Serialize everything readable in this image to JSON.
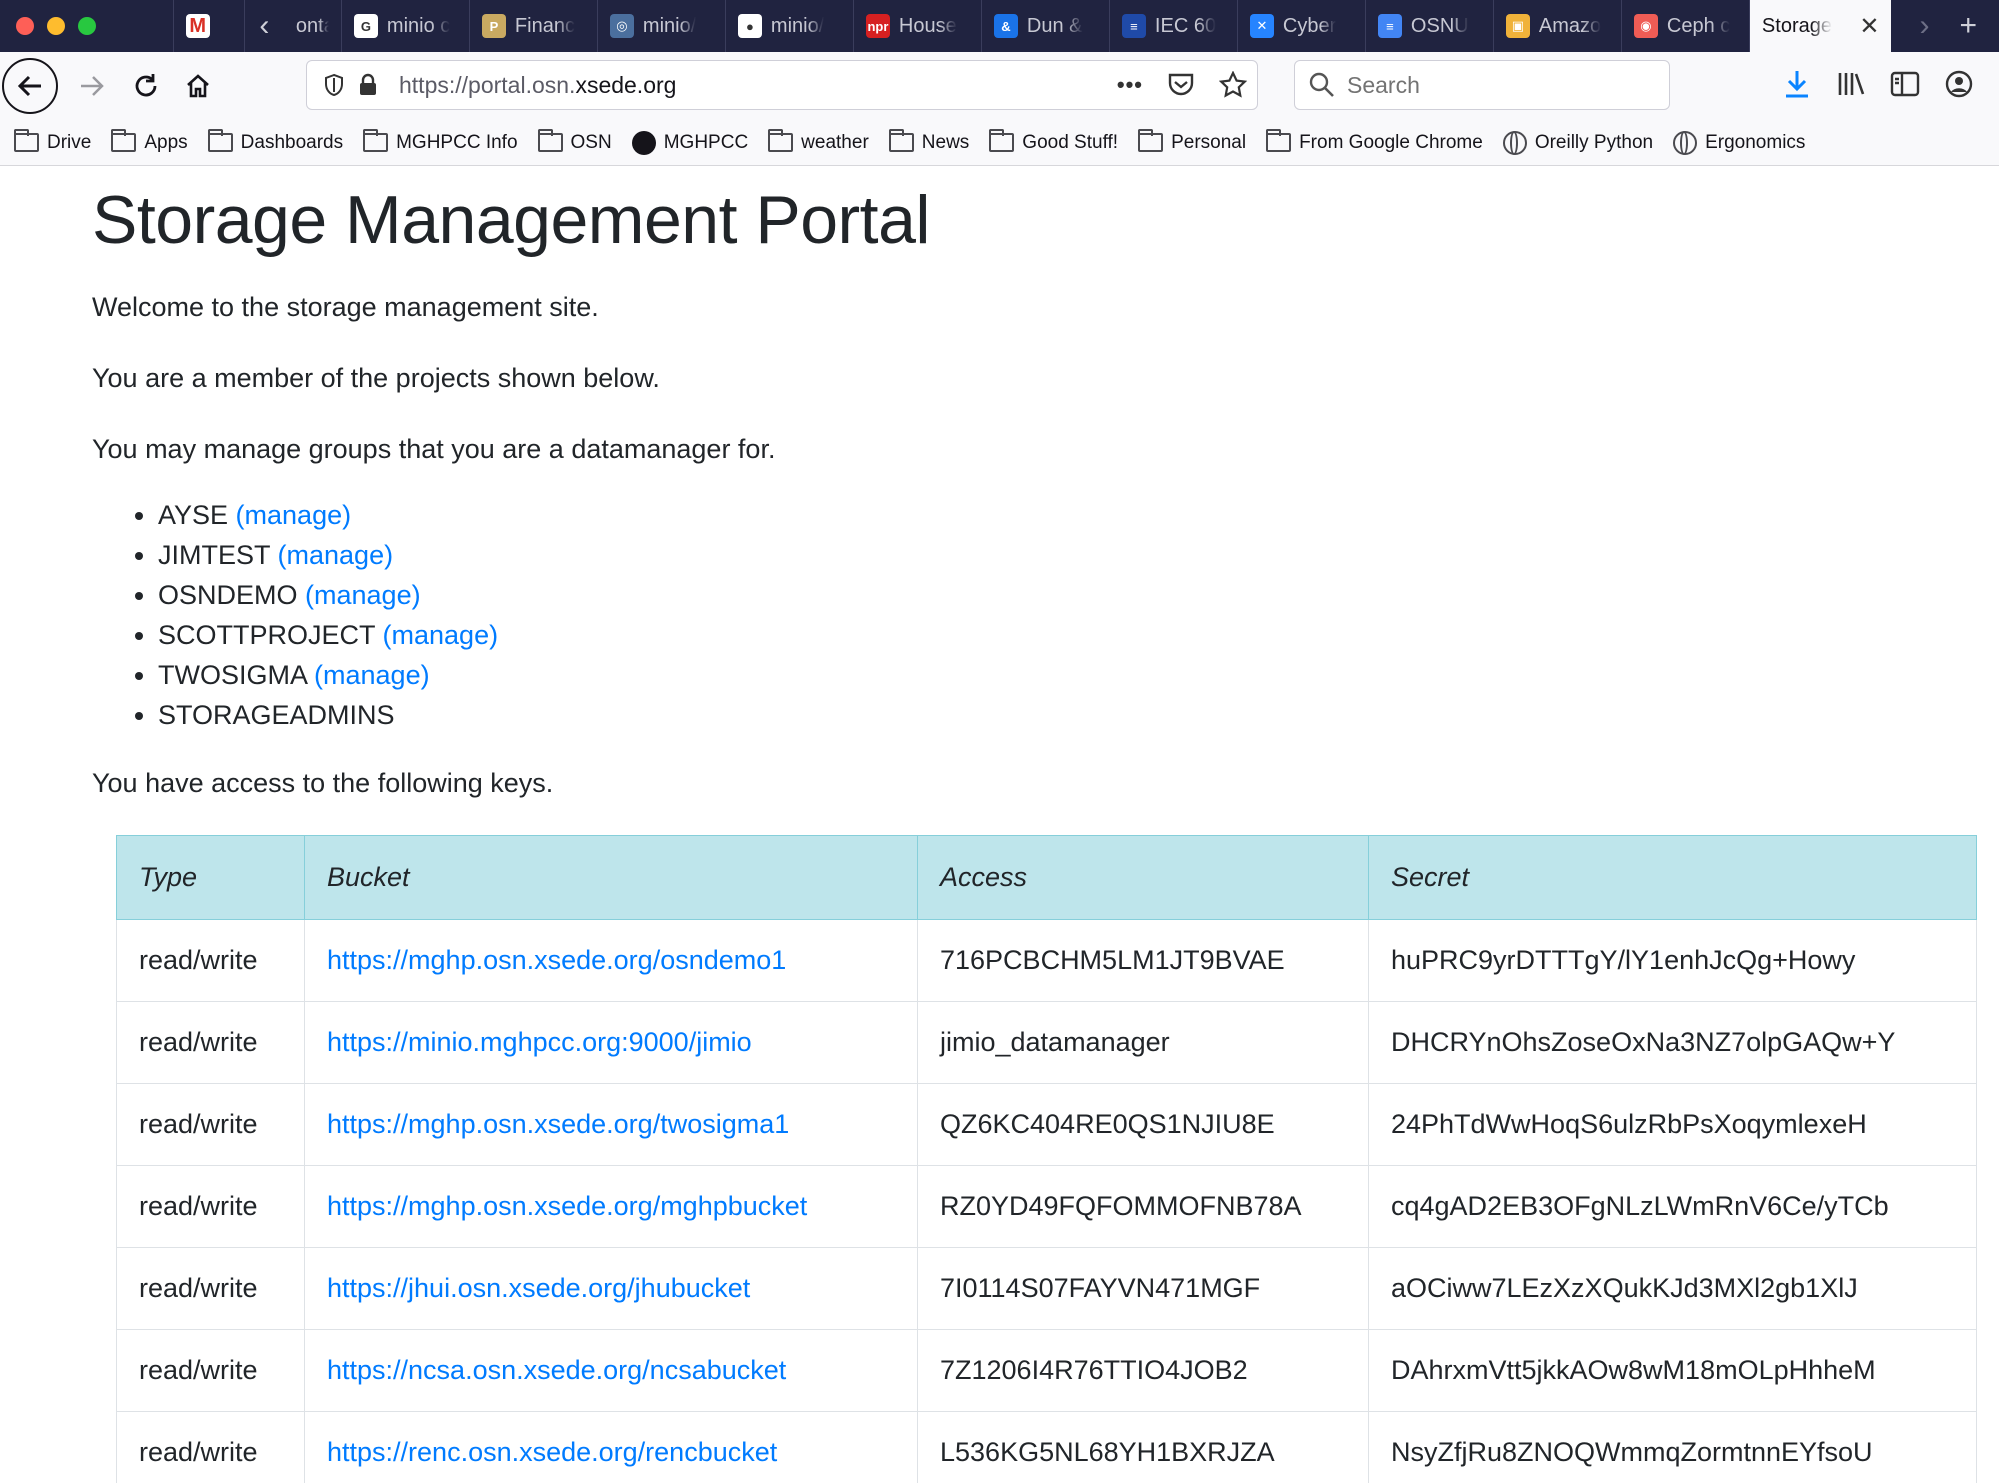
{
  "browser": {
    "tabs": [
      {
        "label": "ontai",
        "icon": "back-tab-icon"
      },
      {
        "label": "minio c",
        "icon": "google-icon"
      },
      {
        "label": "Financ",
        "icon": "purdue-icon"
      },
      {
        "label": "minio/",
        "icon": "globe-icon"
      },
      {
        "label": "minio/",
        "icon": "github-icon"
      },
      {
        "label": "House",
        "icon": "npr-icon"
      },
      {
        "label": "Dun &",
        "icon": "dnb-icon"
      },
      {
        "label": "IEC 60",
        "icon": "iec-icon"
      },
      {
        "label": "Cyber",
        "icon": "confluence-icon"
      },
      {
        "label": "OSNU",
        "icon": "docs-icon"
      },
      {
        "label": "Amazo",
        "icon": "amazon-icon"
      },
      {
        "label": "Ceph c",
        "icon": "ceph-icon"
      }
    ],
    "active_tab": {
      "label": "Storage"
    },
    "url": {
      "prefix": "https://portal.osn.",
      "domain": "xsede.org"
    },
    "search_placeholder": "Search"
  },
  "bookmarks": [
    {
      "label": "Drive",
      "icon": "folder"
    },
    {
      "label": "Apps",
      "icon": "folder"
    },
    {
      "label": "Dashboards",
      "icon": "folder"
    },
    {
      "label": "MGHPCC Info",
      "icon": "folder"
    },
    {
      "label": "OSN",
      "icon": "folder"
    },
    {
      "label": "MGHPCC",
      "icon": "github"
    },
    {
      "label": "weather",
      "icon": "folder"
    },
    {
      "label": "News",
      "icon": "folder"
    },
    {
      "label": "Good Stuff!",
      "icon": "folder"
    },
    {
      "label": "Personal",
      "icon": "folder"
    },
    {
      "label": "From Google Chrome",
      "icon": "folder"
    },
    {
      "label": "Oreilly Python",
      "icon": "globe"
    },
    {
      "label": "Ergonomics",
      "icon": "globe"
    }
  ],
  "page": {
    "title": "Storage Management Portal",
    "welcome": "Welcome to the storage management site.",
    "member": "You are a member of the projects shown below.",
    "manage_note": "You may manage groups that you are a datamanager for.",
    "groups": [
      {
        "name": "AYSE",
        "manage": "(manage)"
      },
      {
        "name": "JIMTEST",
        "manage": "(manage)"
      },
      {
        "name": "OSNDEMO",
        "manage": "(manage)"
      },
      {
        "name": "SCOTTPROJECT",
        "manage": "(manage)"
      },
      {
        "name": "TWOSIGMA",
        "manage": "(manage)"
      },
      {
        "name": "STORAGEADMINS",
        "manage": ""
      }
    ],
    "keys_intro": "You have access to the following keys.",
    "table": {
      "headers": {
        "type": "Type",
        "bucket": "Bucket",
        "access": "Access",
        "secret": "Secret"
      },
      "rows": [
        {
          "type": "read/write",
          "bucket": "https://mghp.osn.xsede.org/osndemo1",
          "access": "716PCBCHM5LM1JT9BVAE",
          "secret": "huPRC9yrDTTTgY/lY1enhJcQg+Howy"
        },
        {
          "type": "read/write",
          "bucket": "https://minio.mghpcc.org:9000/jimio",
          "access": "jimio_datamanager",
          "secret": "DHCRYnOhsZoseOxNa3NZ7olpGAQw+Y"
        },
        {
          "type": "read/write",
          "bucket": "https://mghp.osn.xsede.org/twosigma1",
          "access": "QZ6KC404RE0QS1NJIU8E",
          "secret": "24PhTdWwHoqS6ulzRbPsXoqymlexeH"
        },
        {
          "type": "read/write",
          "bucket": "https://mghp.osn.xsede.org/mghpbucket",
          "access": "RZ0YD49FQFOMMOFNB78A",
          "secret": "cq4gAD2EB3OFgNLzLWmRnV6Ce/yTCb"
        },
        {
          "type": "read/write",
          "bucket": "https://jhui.osn.xsede.org/jhubucket",
          "access": "7I0114S07FAYVN471MGF",
          "secret": "aOCiww7LEzXzXQukKJd3MXl2gb1XlJ"
        },
        {
          "type": "read/write",
          "bucket": "https://ncsa.osn.xsede.org/ncsabucket",
          "access": "7Z1206I4R76TTIO4JOB2",
          "secret": "DAhrxmVtt5jkkAOw8wM18mOLpHhheM"
        },
        {
          "type": "read/write",
          "bucket": "https://renc.osn.xsede.org/rencbucket",
          "access": "L536KG5NL68YH1BXRJZA",
          "secret": "NsyZfjRu8ZNOQWmmqZormtnnEYfsoU"
        }
      ]
    }
  }
}
